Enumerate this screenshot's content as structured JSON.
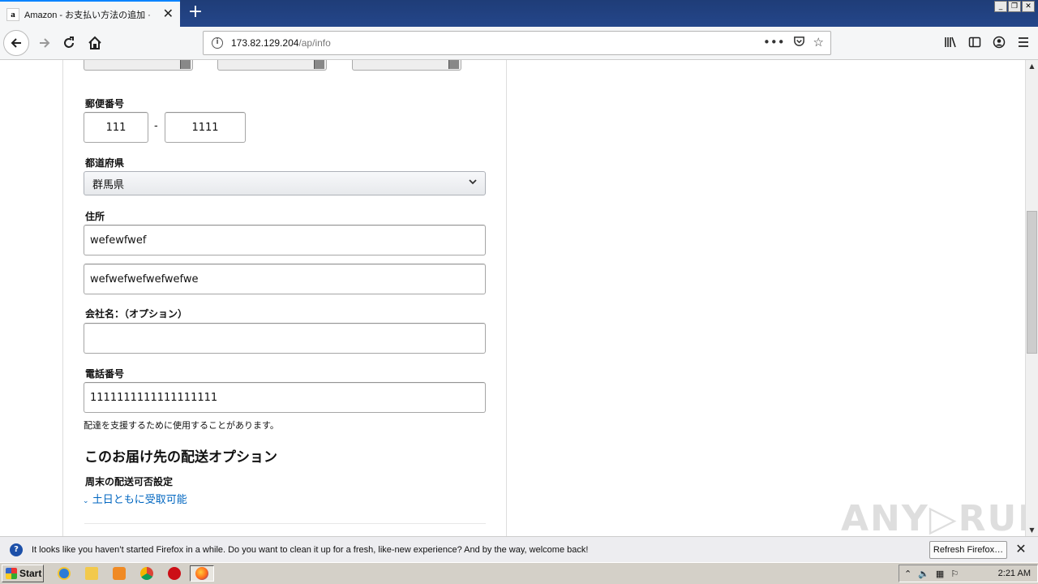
{
  "browser": {
    "tab_title": "Amazon - お支払い方法の追加 · ",
    "tab_favicon": "a",
    "url_host": "173.82.129.204",
    "url_path": "/ap/info",
    "new_tab": "+",
    "tab_close": "✕"
  },
  "form": {
    "zip_label": "郵便番号",
    "zip1": "111",
    "zip_sep": "-",
    "zip2": "1111",
    "pref_label": "都道府県",
    "pref_value": "群馬県",
    "address_label": "住所",
    "address1": "wefewfwef",
    "address2": "wefwefwefwefwefwe",
    "company_label": "会社名：（オプション）",
    "company_value": "",
    "phone_label": "電話番号",
    "phone_value": "1111111111111111111",
    "phone_note": "配達を支援するために使用することがあります。",
    "section_title": "このお届け先の配送オプション",
    "weekend_label": "周末の配送可否設定",
    "weekend_link": "土日ともに受取可能"
  },
  "watermark": "ANY▷RUN",
  "notification": {
    "message": "It looks like you haven’t started Firefox in a while. Do you want to clean it up for a fresh, like-new experience? And by the way, welcome back!",
    "button": "Refresh Firefox…",
    "close": "✕"
  },
  "taskbar": {
    "start": "Start",
    "clock": "2:21 AM"
  },
  "colors": {
    "link": "#0066c0",
    "tabbar": "#1f3d78"
  }
}
